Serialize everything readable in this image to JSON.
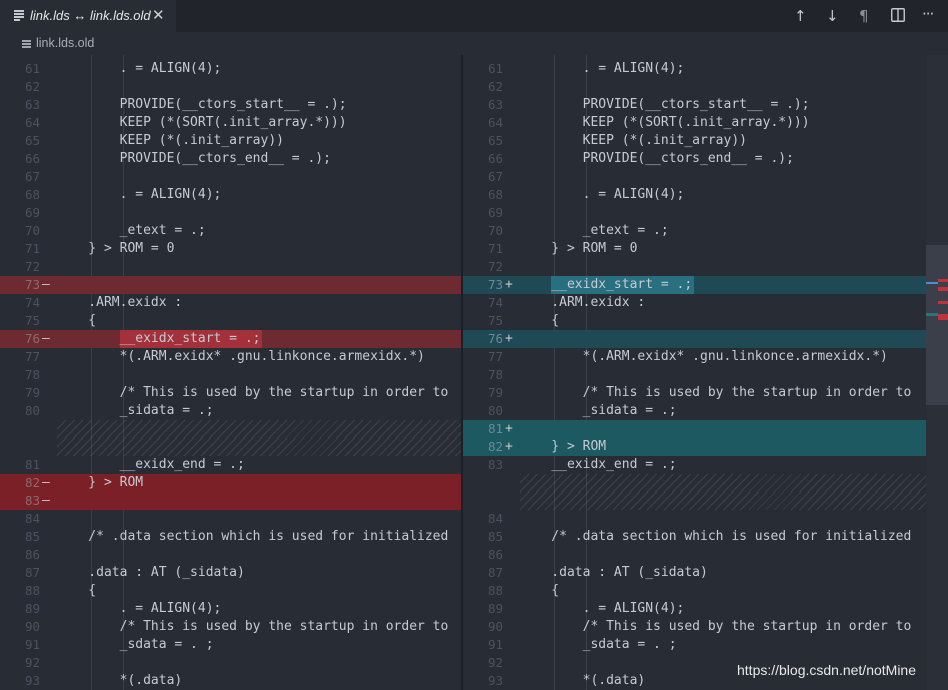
{
  "tab": {
    "title": "link.lds ↔ link.lds.old",
    "close_glyph": "✕",
    "icon": "file-lines-icon"
  },
  "actions": {
    "prev_change": "↑",
    "next_change": "↓",
    "whitespace": "¶",
    "split": "split-editor-icon",
    "more": "···"
  },
  "breadcrumb": {
    "file": "link.lds.old"
  },
  "colors": {
    "deleted": "#7a2026",
    "inserted": "#1d5961"
  },
  "left": {
    "rows": [
      {
        "n": "61",
        "code": "        . = ALIGN(4);"
      },
      {
        "n": "62",
        "code": ""
      },
      {
        "n": "63",
        "code": "        PROVIDE(__ctors_start__ = .);"
      },
      {
        "n": "64",
        "code": "        KEEP (*(SORT(.init_array.*)))"
      },
      {
        "n": "65",
        "code": "        KEEP (*(.init_array))"
      },
      {
        "n": "66",
        "code": "        PROVIDE(__ctors_end__ = .);"
      },
      {
        "n": "67",
        "code": ""
      },
      {
        "n": "68",
        "code": "        . = ALIGN(4);"
      },
      {
        "n": "69",
        "code": ""
      },
      {
        "n": "70",
        "code": "        _etext = .;"
      },
      {
        "n": "71",
        "code": "    } > ROM = 0"
      },
      {
        "n": "72",
        "code": ""
      },
      {
        "n": "73",
        "code": "",
        "mark": "—",
        "type": "del"
      },
      {
        "n": "74",
        "code": "    .ARM.exidx :"
      },
      {
        "n": "75",
        "code": "    {"
      },
      {
        "n": "76",
        "code": "        __exidx_start = .;",
        "mark": "—",
        "type": "del"
      },
      {
        "n": "77",
        "code": "        *(.ARM.exidx* .gnu.linkonce.armexidx.*)"
      },
      {
        "n": "78",
        "code": ""
      },
      {
        "n": "79",
        "code": "        /* This is used by the startup in order to"
      },
      {
        "n": "80",
        "code": "        _sidata = .;"
      },
      {
        "n": "",
        "code": "",
        "type": "filler"
      },
      {
        "n": "",
        "code": "",
        "type": "filler"
      },
      {
        "n": "81",
        "code": "        __exidx_end = .;"
      },
      {
        "n": "82",
        "code": "    } > ROM",
        "mark": "—",
        "type": "delstrong"
      },
      {
        "n": "83",
        "code": "",
        "mark": "—",
        "type": "delstrong"
      },
      {
        "n": "84",
        "code": ""
      },
      {
        "n": "85",
        "code": "    /* .data section which is used for initialized"
      },
      {
        "n": "86",
        "code": ""
      },
      {
        "n": "87",
        "code": "    .data : AT (_sidata)"
      },
      {
        "n": "88",
        "code": "    {"
      },
      {
        "n": "89",
        "code": "        . = ALIGN(4);"
      },
      {
        "n": "90",
        "code": "        /* This is used by the startup in order to"
      },
      {
        "n": "91",
        "code": "        _sdata = . ;"
      },
      {
        "n": "92",
        "code": ""
      },
      {
        "n": "93",
        "code": "        *(.data)"
      }
    ]
  },
  "right": {
    "rows": [
      {
        "n": "61",
        "code": "        . = ALIGN(4);"
      },
      {
        "n": "62",
        "code": ""
      },
      {
        "n": "63",
        "code": "        PROVIDE(__ctors_start__ = .);"
      },
      {
        "n": "64",
        "code": "        KEEP (*(SORT(.init_array.*)))"
      },
      {
        "n": "65",
        "code": "        KEEP (*(.init_array))"
      },
      {
        "n": "66",
        "code": "        PROVIDE(__ctors_end__ = .);"
      },
      {
        "n": "67",
        "code": ""
      },
      {
        "n": "68",
        "code": "        . = ALIGN(4);"
      },
      {
        "n": "69",
        "code": ""
      },
      {
        "n": "70",
        "code": "        _etext = .;"
      },
      {
        "n": "71",
        "code": "    } > ROM = 0"
      },
      {
        "n": "72",
        "code": ""
      },
      {
        "n": "73",
        "code": "    __exidx_start = .;",
        "mark": "+",
        "type": "ins"
      },
      {
        "n": "74",
        "code": "    .ARM.exidx :"
      },
      {
        "n": "75",
        "code": "    {"
      },
      {
        "n": "76",
        "code": "",
        "mark": "+",
        "type": "ins"
      },
      {
        "n": "77",
        "code": "        *(.ARM.exidx* .gnu.linkonce.armexidx.*)"
      },
      {
        "n": "78",
        "code": ""
      },
      {
        "n": "79",
        "code": "        /* This is used by the startup in order to"
      },
      {
        "n": "80",
        "code": "        _sidata = .;"
      },
      {
        "n": "81",
        "code": "",
        "mark": "+",
        "type": "insstrong"
      },
      {
        "n": "82",
        "code": "    } > ROM",
        "mark": "+",
        "type": "insstrong"
      },
      {
        "n": "83",
        "code": "    __exidx_end = .;"
      },
      {
        "n": "",
        "code": "",
        "type": "filler"
      },
      {
        "n": "",
        "code": "",
        "type": "filler"
      },
      {
        "n": "84",
        "code": ""
      },
      {
        "n": "85",
        "code": "    /* .data section which is used for initialized"
      },
      {
        "n": "86",
        "code": ""
      },
      {
        "n": "87",
        "code": "    .data : AT (_sidata)"
      },
      {
        "n": "88",
        "code": "    {"
      },
      {
        "n": "89",
        "code": "        . = ALIGN(4);"
      },
      {
        "n": "90",
        "code": "        /* This is used by the startup in order to"
      },
      {
        "n": "91",
        "code": "        _sdata = . ;"
      },
      {
        "n": "92",
        "code": ""
      },
      {
        "n": "93",
        "code": "        *(.data)"
      }
    ]
  },
  "watermark": "https://blog.csdn.net/notMine"
}
